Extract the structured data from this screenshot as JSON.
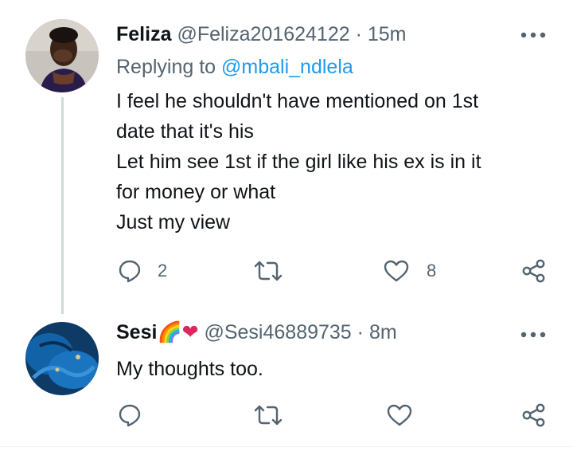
{
  "tweets": [
    {
      "name": "Feliza",
      "handle": "@Feliza201624122",
      "separator": "·",
      "time": "15m",
      "replying_label": "Replying to",
      "replying_handle": "@mbali_ndlela",
      "lines": [
        "I feel he shouldn't have mentioned on 1st",
        "date that it's his",
        "Let him see 1st if the girl like his ex is in it",
        "for money or what",
        "Just my view"
      ],
      "reply_count": "2",
      "retweet_count": "",
      "like_count": "8"
    },
    {
      "name": "Sesi",
      "name_emoji": "🌈❤",
      "handle": "@Sesi46889735",
      "separator": "·",
      "time": "8m",
      "lines": [
        "My thoughts too."
      ],
      "reply_count": "",
      "retweet_count": "",
      "like_count": ""
    }
  ],
  "icons": {
    "more": "more-horizontal-icon",
    "reply": "reply-icon",
    "retweet": "retweet-icon",
    "like": "heart-icon",
    "share": "share-icon"
  },
  "colors": {
    "text": "#0f1419",
    "secondary": "#536471",
    "link": "#1d9bf0",
    "thread_line": "#cfd9de"
  }
}
